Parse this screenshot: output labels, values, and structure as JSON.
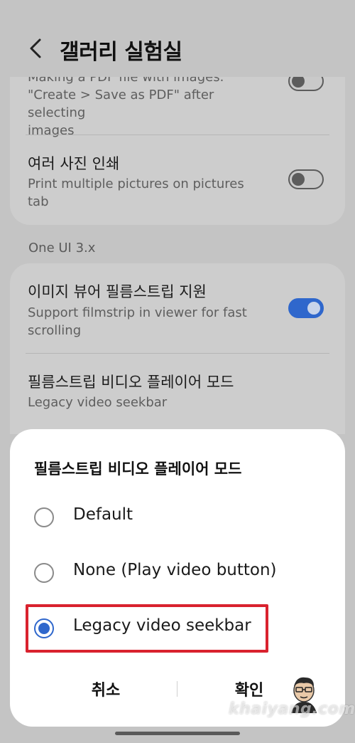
{
  "header": {
    "title": "갤러리 실험실"
  },
  "card1": {
    "partial_row": {
      "subtitle_lines": [
        "Making a PDF file with images.",
        "\"Create > Save as PDF\" after selecting",
        "images"
      ]
    },
    "row2": {
      "title": "여러 사진 인쇄",
      "subtitle_lines": [
        "Print multiple pictures on pictures",
        "tab"
      ],
      "toggle_on": false
    }
  },
  "section_label": "One UI 3.x",
  "card2": {
    "row1": {
      "title": "이미지 뷰어 필름스트립 지원",
      "subtitle_lines": [
        "Support filmstrip in viewer for fast",
        "scrolling"
      ],
      "toggle_on": true
    },
    "row2": {
      "title": "필름스트립 비디오 플레이어 모드",
      "subtitle": "Legacy video seekbar"
    }
  },
  "dialog": {
    "title": "필름스트립 비디오 플레이어 모드",
    "options": [
      {
        "label": "Default",
        "checked": false
      },
      {
        "label": "None (Play video button)",
        "checked": false
      },
      {
        "label": "Legacy video seekbar",
        "checked": true
      }
    ],
    "cancel_label": "취소",
    "ok_label": "확인"
  },
  "watermark": "khaiyang.com",
  "colors": {
    "accent": "#2f67cc",
    "highlight": "#d9222e",
    "dim_background": "#c4c4c4"
  },
  "icons": {
    "back": "chevron-left-icon",
    "avatar": "cartoon-avatar-icon"
  }
}
